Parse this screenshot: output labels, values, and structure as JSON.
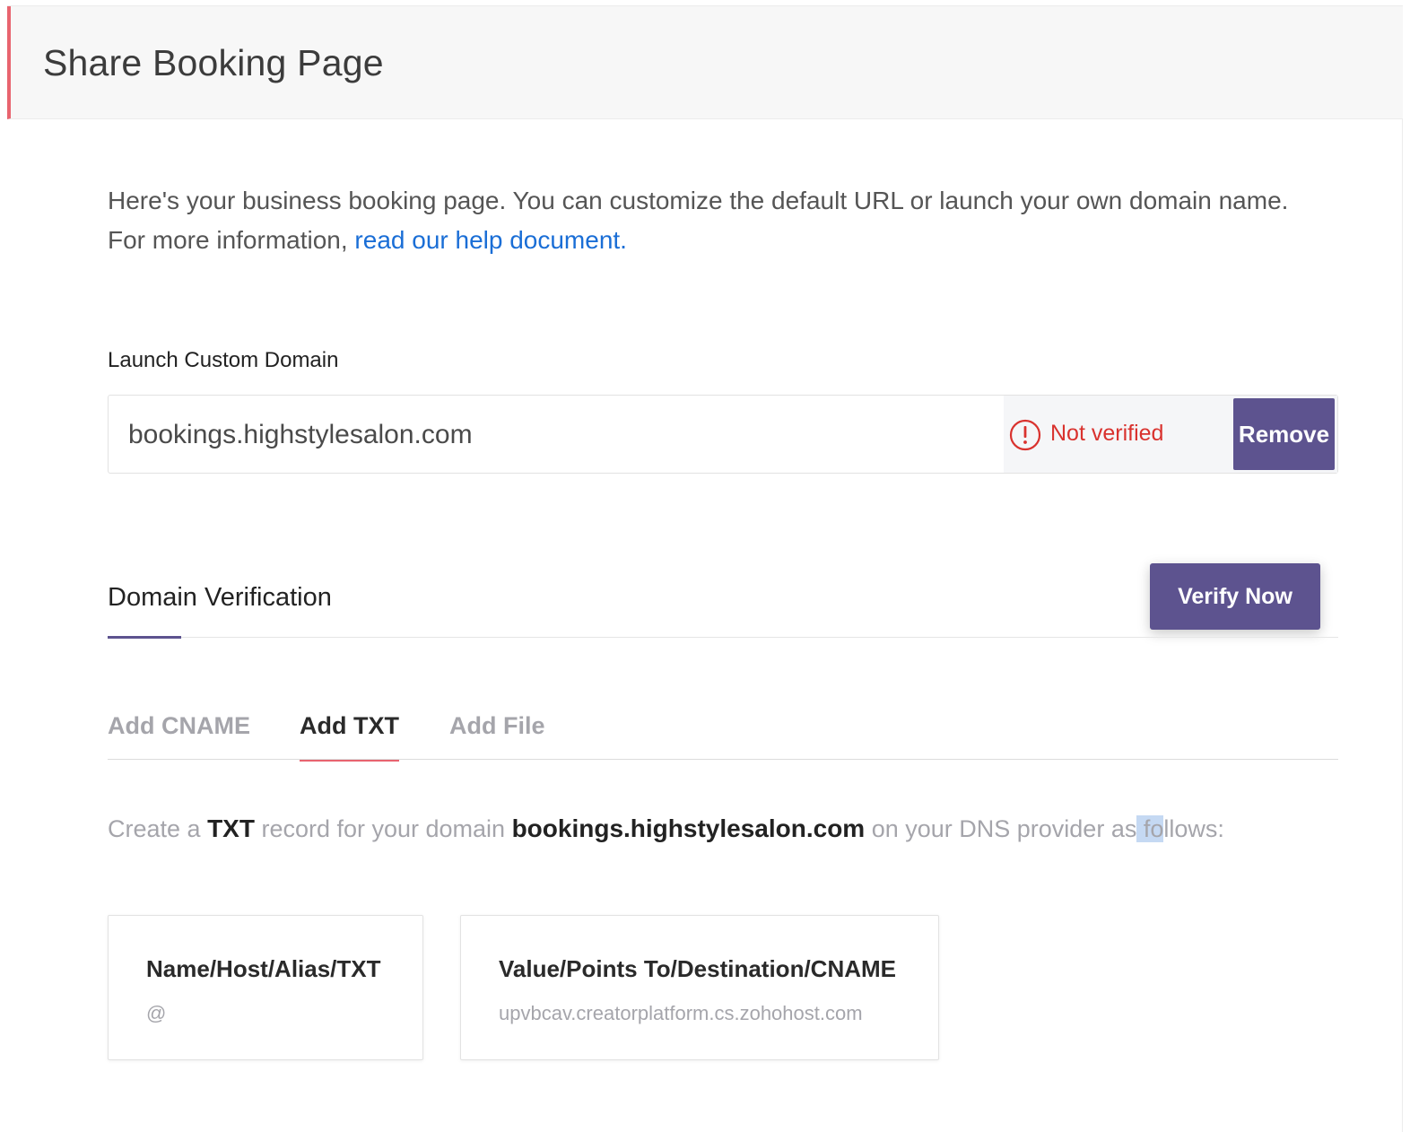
{
  "header": {
    "title": "Share Booking Page"
  },
  "intro": {
    "text": "Here's your business booking page. You can customize the default URL or launch your own domain name. For more information, ",
    "link": "read our help document."
  },
  "custom_domain": {
    "label": "Launch Custom Domain",
    "value": "bookings.highstylesalon.com",
    "status": "Not verified",
    "status_color": "#d9322e",
    "remove_label": "Remove"
  },
  "verification": {
    "title": "Domain Verification",
    "verify_label": "Verify Now",
    "tabs": [
      "Add CNAME",
      "Add TXT",
      "Add File"
    ],
    "active_tab": "Add TXT",
    "instruction": {
      "part1": "Create a ",
      "record": "TXT",
      "part2": " record for your domain ",
      "domain": "bookings.highstylesalon.com",
      "part3a": " on your DNS provider as",
      "part3_highlight": " fo",
      "part3b": "llows:"
    },
    "records": [
      {
        "title": "Name/Host/Alias/TXT",
        "value": "@"
      },
      {
        "title": "Value/Points To/Destination/CNAME",
        "value": "upvbcav.creatorplatform.cs.zohohost.com"
      }
    ]
  },
  "colors": {
    "accent": "#5d538f",
    "tab_underline": "#e8646f",
    "link": "#1a6ed6"
  }
}
